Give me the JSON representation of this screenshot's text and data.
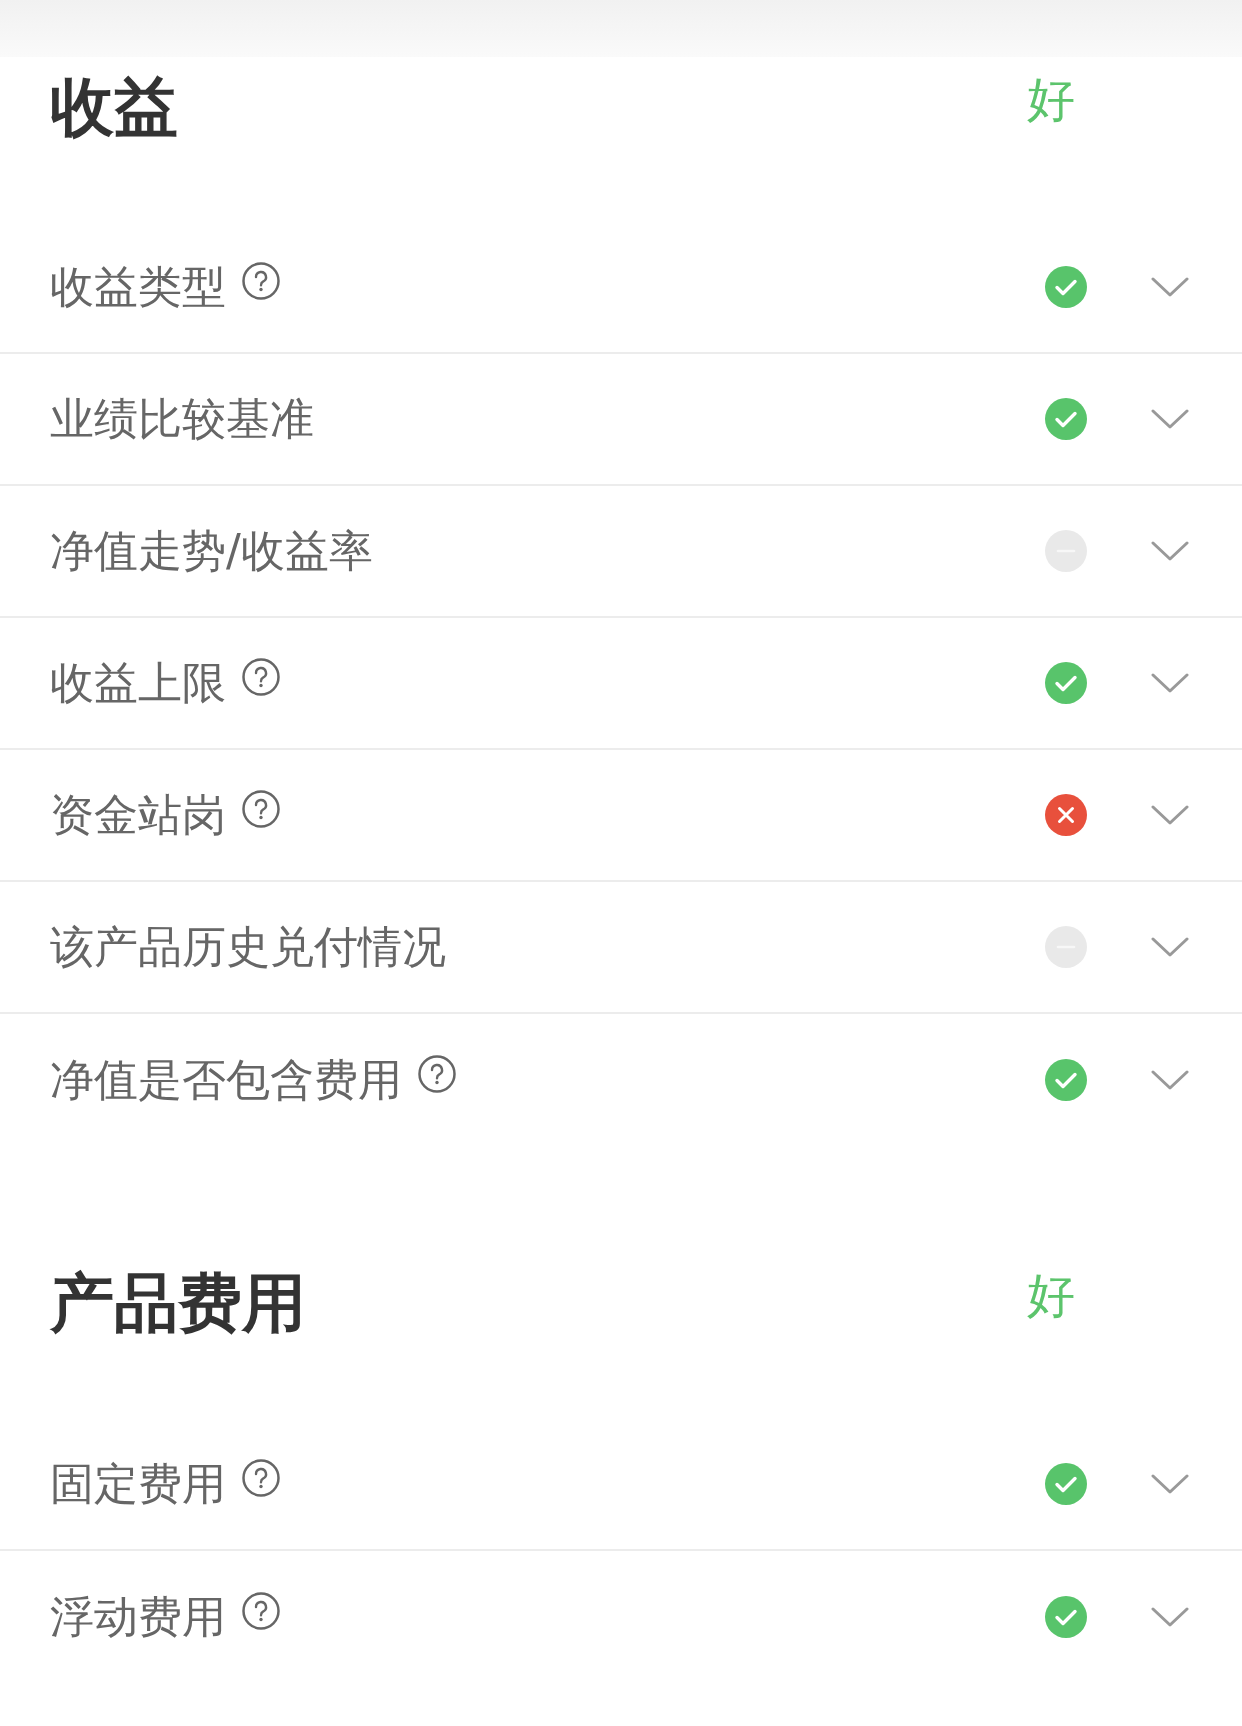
{
  "sections": [
    {
      "title": "收益",
      "rating": "好",
      "rows": [
        {
          "label": "收益类型",
          "help": true,
          "kind": "pass"
        },
        {
          "label": "业绩比较基准",
          "help": false,
          "kind": "pass"
        },
        {
          "label": "净值走势/收益率",
          "help": false,
          "kind": "none"
        },
        {
          "label": "收益上限",
          "help": true,
          "kind": "pass"
        },
        {
          "label": "资金站岗",
          "help": true,
          "kind": "fail"
        },
        {
          "label": "该产品历史兑付情况",
          "help": false,
          "kind": "none"
        },
        {
          "label": "净值是否包含费用",
          "help": true,
          "kind": "pass"
        }
      ]
    },
    {
      "title": "产品费用",
      "rating": "好",
      "rows": [
        {
          "label": "固定费用",
          "help": true,
          "kind": "pass"
        },
        {
          "label": "浮动费用",
          "help": true,
          "kind": "pass"
        }
      ]
    }
  ]
}
